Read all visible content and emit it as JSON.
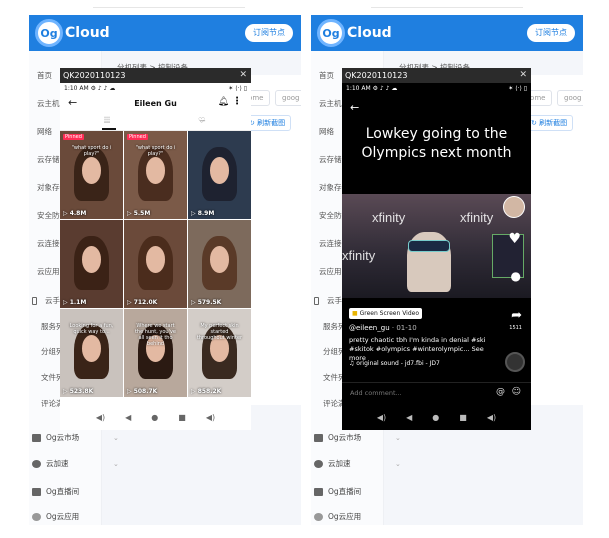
{
  "app": {
    "logo_mark": "Og",
    "logo_text": "Cloud",
    "subscribe_label": "订阅节点",
    "breadcrumb": "分机列表 > 控制设备",
    "chips": [
      "Chrome",
      "goog"
    ],
    "refresh_label": "刷新截图"
  },
  "sidebar": {
    "items": [
      {
        "label": "首页"
      },
      {
        "label": "云主机"
      },
      {
        "label": "网络"
      },
      {
        "label": "云存储"
      },
      {
        "label": "对象存储"
      },
      {
        "label": "安全防护"
      },
      {
        "label": "云连接"
      },
      {
        "label": "云应用"
      },
      {
        "label": "云手机"
      },
      {
        "label": "服务列表"
      },
      {
        "label": "分组列表"
      },
      {
        "label": "文件列表"
      },
      {
        "label": "评论满意"
      }
    ],
    "bottom": [
      {
        "label": "Og云市场"
      },
      {
        "label": "云加速"
      },
      {
        "label": "Og直播间"
      },
      {
        "label": "Og云应用"
      }
    ]
  },
  "phone_left": {
    "title": "QK2020110123",
    "time": "1:10 AM",
    "status_icons": "⚙ ♪ ♪ ☁",
    "status_right": "✶ ⟨·⟩ ▯",
    "profile_name": "Eileen Gu",
    "pinned_label": "Pinned",
    "thumbs": [
      {
        "views": "4.8M",
        "caption": "\"what sport do i play?\""
      },
      {
        "views": "5.5M",
        "caption": "\"what sport do i play?\""
      },
      {
        "views": "8.9M",
        "caption": ""
      },
      {
        "views": "1.1M",
        "caption": ""
      },
      {
        "views": "712.0K",
        "caption": ""
      },
      {
        "views": "579.5K",
        "caption": ""
      },
      {
        "views": "523.8K",
        "caption": "Looking for a fun, quick way to..."
      },
      {
        "views": "508.7K",
        "caption": "Where we start the hunt, you've all seen it tho behind"
      },
      {
        "views": "858.2K",
        "caption": "My perfect skin started throughout winter"
      }
    ]
  },
  "phone_right": {
    "title": "QK2020110123",
    "time": "1:10 AM",
    "status_icons": "⚙ ♪ ♪ ☁",
    "status_right": "✶ ⟨·⟩ ▯",
    "video_caption": "Lowkey going to the Olympics next month",
    "brand_text": "xfinity",
    "green_screen_label": "Green Screen Video",
    "author": "@eileen_gu",
    "date": "· 01-10",
    "description": "pretty chaotic tbh I'm kinda in denial #ski #skitok #olympics #winterolympic... See more",
    "sound": "original sound - jd7.fbi - JD7",
    "share_count": "1511",
    "comment_placeholder": "Add comment..."
  },
  "nav_glyphs": [
    "◀)",
    "◀",
    "●",
    "■",
    "◀)"
  ]
}
